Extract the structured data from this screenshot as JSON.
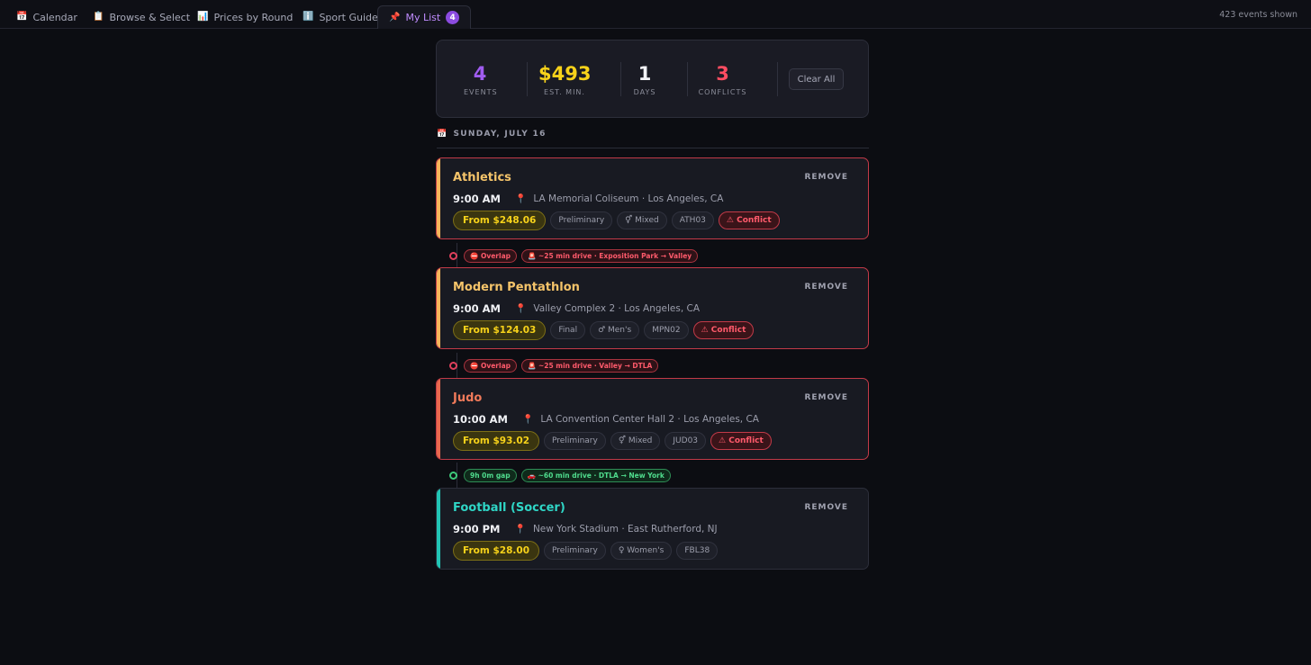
{
  "tabs": [
    {
      "icon": "📅",
      "label": "Calendar"
    },
    {
      "icon": "📋",
      "label": "Browse & Select"
    },
    {
      "icon": "📊",
      "label": "Prices by Round"
    },
    {
      "icon": "ℹ️",
      "label": "Sport Guide"
    },
    {
      "icon": "📌",
      "label": "My List",
      "badge": "4"
    }
  ],
  "events_shown": "423 events shown",
  "stats": {
    "events": {
      "value": "4",
      "label": "EVENTS"
    },
    "est_min": {
      "value": "$493",
      "label": "EST. MIN."
    },
    "days": {
      "value": "1",
      "label": "DAYS"
    },
    "conflicts": {
      "value": "3",
      "label": "CONFLICTS"
    },
    "clear_label": "Clear All"
  },
  "day": {
    "icon": "📅",
    "label": "SUNDAY, JULY 16"
  },
  "remove_label": "REMOVE",
  "cards": [
    {
      "title": "Athletics",
      "title_color": "#f5c46a",
      "stripe": "#f5b45a",
      "time": "9:00 AM",
      "venue": "LA Memorial Coliseum · Los Angeles, CA",
      "price": "From $248.06",
      "round": "Preliminary",
      "gender": "⚥ Mixed",
      "code": "ATH03",
      "conflict": "⚠ Conflict"
    },
    {
      "title": "Modern Pentathlon",
      "title_color": "#f5c46a",
      "stripe": "#f5b45a",
      "time": "9:00 AM",
      "venue": "Valley Complex 2 · Los Angeles, CA",
      "price": "From $124.03",
      "round": "Final",
      "gender": "♂ Men's",
      "code": "MPN02",
      "conflict": "⚠ Conflict"
    },
    {
      "title": "Judo",
      "title_color": "#f07a5a",
      "stripe": "#e8684e",
      "time": "10:00 AM",
      "venue": "LA Convention Center Hall 2 · Los Angeles, CA",
      "price": "From $93.02",
      "round": "Preliminary",
      "gender": "⚥ Mixed",
      "code": "JUD03",
      "conflict": "⚠ Conflict"
    },
    {
      "title": "Football (Soccer)",
      "title_color": "#2fd6c6",
      "stripe": "#21c4b4",
      "time": "9:00 PM",
      "venue": "New York Stadium · East Rutherford, NJ",
      "price": "From $28.00",
      "round": "Preliminary",
      "gender": "♀ Women's",
      "code": "FBL38"
    }
  ],
  "connectors": [
    {
      "status": "⛔ Overlap",
      "travel": "🚨 ~25 min drive · Exposition Park → Valley"
    },
    {
      "status": "⛔ Overlap",
      "travel": "🚨 ~25 min drive · Valley → DTLA"
    },
    {
      "status": "9h 0m gap",
      "travel": "🚗 ~60 min drive · DTLA → New York"
    }
  ],
  "colors": {
    "events": "#a05cf0",
    "est_min": "#f7d21a",
    "days": "#f1f2f6",
    "conflicts": "#ff4d62"
  }
}
